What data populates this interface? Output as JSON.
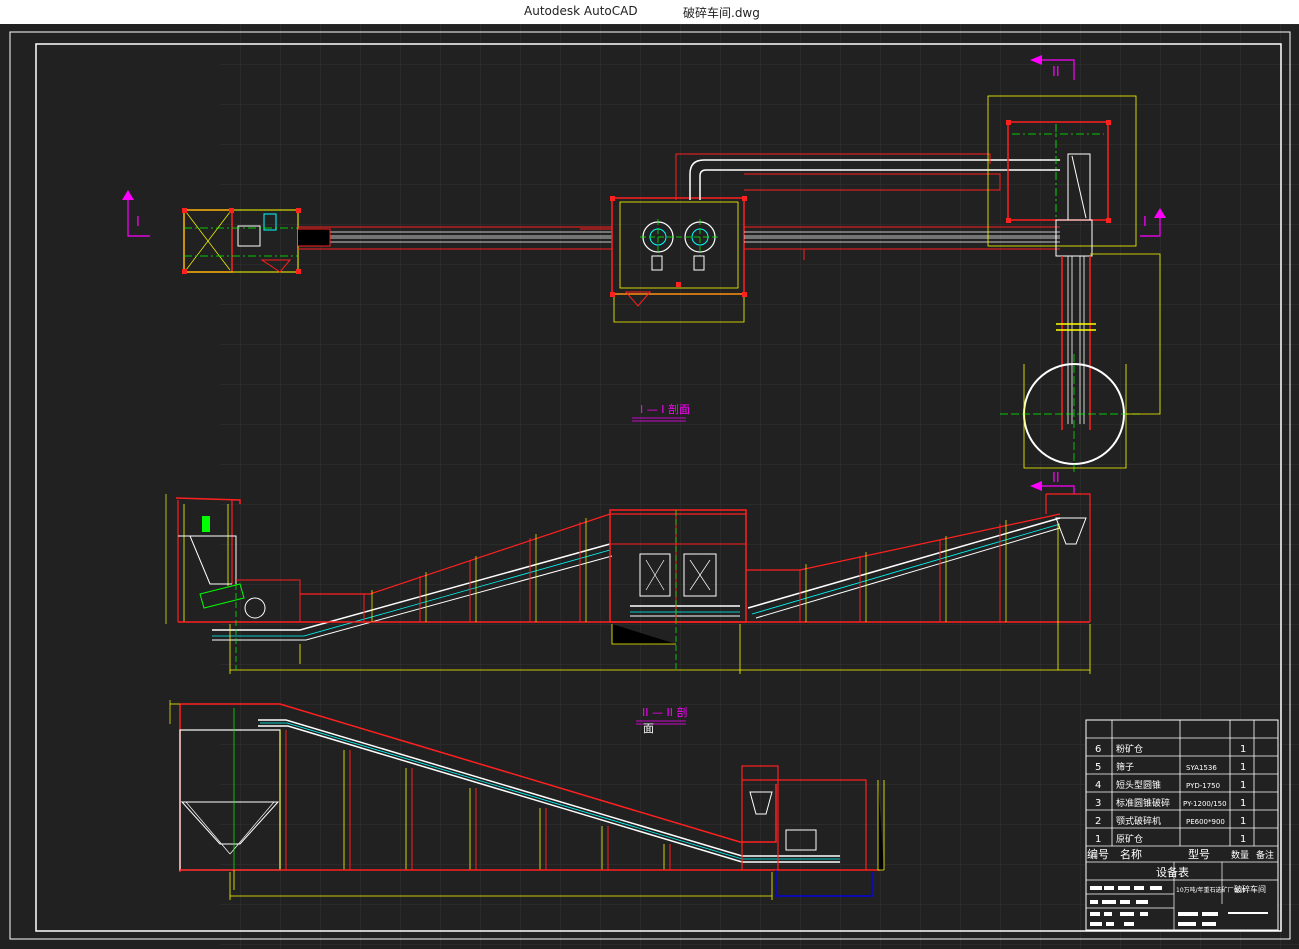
{
  "window": {
    "app_name": "Autodesk AutoCAD",
    "file_name": "破碎车间.dwg"
  },
  "drawing": {
    "section_marks": {
      "I_left": "I",
      "I_right": "I",
      "II_top": "II",
      "II_bottom": "II"
    },
    "section_titles": {
      "section_1": "I — I 剖面",
      "section_2_line1": "II — II 剖",
      "section_2_line2": "面"
    },
    "colors": {
      "background": "#212121",
      "red": "#ff2020",
      "yellow": "#ffff00",
      "white": "#ffffff",
      "green": "#00ff00",
      "magenta": "#ff00ff",
      "cyan": "#00ffff"
    }
  },
  "equipment_table": {
    "title": "设备表",
    "headers": {
      "no": "编号",
      "name": "名称",
      "model": "型号",
      "qty": "数量",
      "remark": "备注"
    },
    "rows": [
      {
        "no": "6",
        "name": "粉矿仓",
        "model": "",
        "qty": "1"
      },
      {
        "no": "5",
        "name": "筛子",
        "model": "SYA1536",
        "qty": "1"
      },
      {
        "no": "4",
        "name": "短头型圆锥",
        "model": "PYD-1750",
        "qty": "1"
      },
      {
        "no": "3",
        "name": "标准圆锥破碎",
        "model": "PY-1200/150",
        "qty": "1"
      },
      {
        "no": "2",
        "name": "颚式破碎机",
        "model": "PE600*900",
        "qty": "1"
      },
      {
        "no": "1",
        "name": "原矿仓",
        "model": "",
        "qty": "1"
      }
    ]
  },
  "title_block": {
    "project": "10万吨/年重石选矿厂设计",
    "sheet": "破碎车间"
  }
}
